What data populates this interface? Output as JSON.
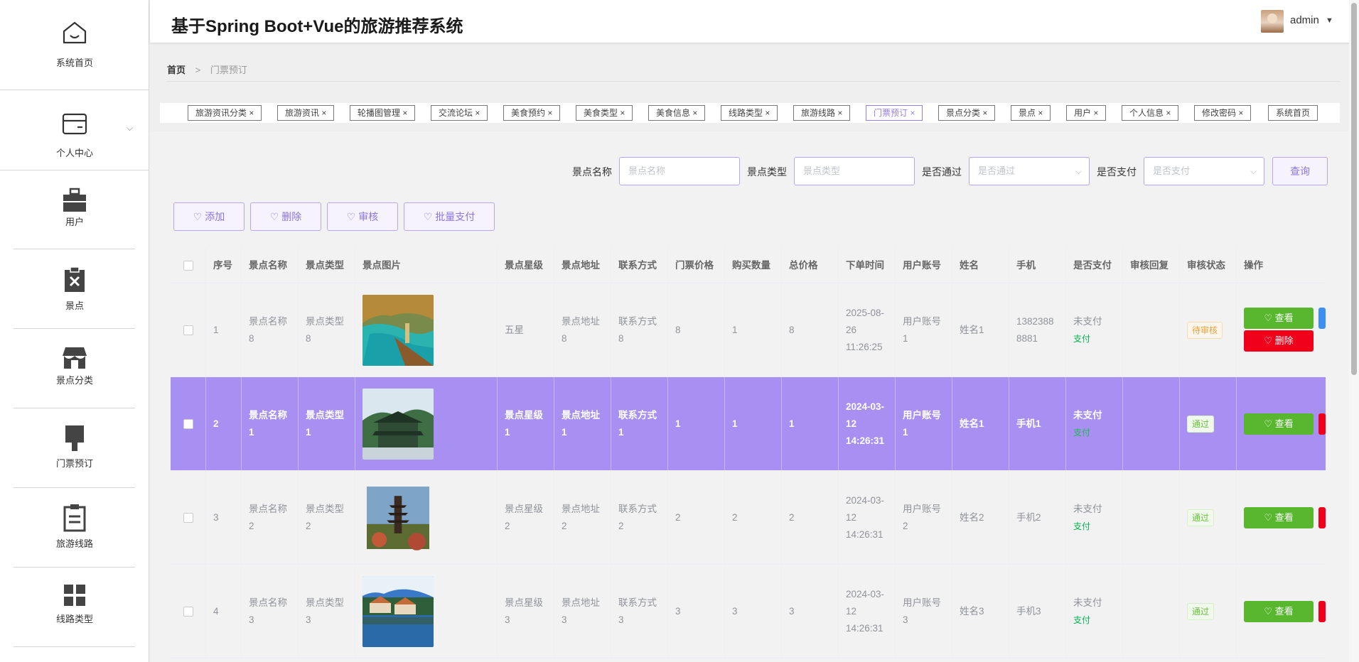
{
  "app": {
    "title": "基于Spring Boot+Vue的旅游推荐系统",
    "user": "admin"
  },
  "sidebar": {
    "items": [
      {
        "label": "系统首页",
        "icon": "home-icon"
      },
      {
        "label": "个人中心",
        "icon": "card-icon"
      },
      {
        "label": "用户",
        "icon": "briefcase-icon"
      },
      {
        "label": "景点",
        "icon": "clipboard-x-icon"
      },
      {
        "label": "景点分类",
        "icon": "shop-icon"
      },
      {
        "label": "门票预订",
        "icon": "brush-icon"
      },
      {
        "label": "旅游线路",
        "icon": "clipboard-list-icon"
      },
      {
        "label": "线路类型",
        "icon": "grid-icon"
      }
    ]
  },
  "breadcrumb": {
    "home": "首页",
    "sep": ">",
    "current": "门票预订"
  },
  "tags": [
    "旅游资讯分类",
    "旅游资讯",
    "轮播图管理",
    "交流论坛",
    "美食预约",
    "美食类型",
    "美食信息",
    "线路类型",
    "旅游线路",
    "门票预订",
    "景点分类",
    "景点",
    "用户",
    "个人信息",
    "修改密码",
    "系统首页"
  ],
  "search": {
    "name_label": "景点名称",
    "name_placeholder": "景点名称",
    "type_label": "景点类型",
    "type_placeholder": "景点类型",
    "pass_label": "是否通过",
    "pass_placeholder": "是否通过",
    "paid_label": "是否支付",
    "paid_placeholder": "是否支付",
    "query": "查询"
  },
  "actions": {
    "add": "添加",
    "delete": "删除",
    "review": "审核",
    "batch_pay": "批量支付"
  },
  "table": {
    "headers": [
      "序号",
      "景点名称",
      "景点类型",
      "景点图片",
      "景点星级",
      "景点地址",
      "联系方式",
      "门票价格",
      "购买数量",
      "总价格",
      "下单时间",
      "用户账号",
      "姓名",
      "手机",
      "是否支付",
      "审核回复",
      "审核状态",
      "操作"
    ],
    "rows": [
      {
        "no": "1",
        "name": "景点名称8",
        "type": "景点类型8",
        "star": "五星",
        "addr": "景点地址8",
        "contact": "联系方式8",
        "price": "8",
        "qty": "1",
        "total": "8",
        "time": "2025-08-26 11:26:25",
        "account": "用户账号1",
        "person": "姓名1",
        "phone": "13823888881",
        "paid": "未支付",
        "pay_link": "支付",
        "reply": "",
        "status": "待审核",
        "view": "查看",
        "del": "删除",
        "photo_icon": "scenic-photo-lake"
      },
      {
        "no": "2",
        "name": "景点名称1",
        "type": "景点类型1",
        "star": "景点星级1",
        "addr": "景点地址1",
        "contact": "联系方式1",
        "price": "1",
        "qty": "1",
        "total": "1",
        "time": "2024-03-12 14:26:31",
        "account": "用户账号1",
        "person": "姓名1",
        "phone": "手机1",
        "paid": "未支付",
        "pay_link": "支付",
        "reply": "",
        "status": "通过",
        "view": "查看",
        "photo_icon": "scenic-photo-pavilion"
      },
      {
        "no": "3",
        "name": "景点名称2",
        "type": "景点类型2",
        "star": "景点星级2",
        "addr": "景点地址2",
        "contact": "联系方式2",
        "price": "2",
        "qty": "2",
        "total": "2",
        "time": "2024-03-12 14:26:31",
        "account": "用户账号2",
        "person": "姓名2",
        "phone": "手机2",
        "paid": "未支付",
        "pay_link": "支付",
        "reply": "",
        "status": "通过",
        "view": "查看",
        "photo_icon": "scenic-photo-pagoda"
      },
      {
        "no": "4",
        "name": "景点名称3",
        "type": "景点类型3",
        "star": "景点星级3",
        "addr": "景点地址3",
        "contact": "联系方式3",
        "price": "3",
        "qty": "3",
        "total": "3",
        "time": "2024-03-12 14:26:31",
        "account": "用户账号3",
        "person": "姓名3",
        "phone": "手机3",
        "paid": "未支付",
        "pay_link": "支付",
        "reply": "",
        "status": "通过",
        "view": "查看",
        "photo_icon": "scenic-photo-town"
      }
    ]
  },
  "colors": {
    "accent": "#a890f2",
    "view": "#58b72e",
    "delete": "#f0001a",
    "pending": "#e6a23c",
    "pass": "#67c23a"
  }
}
